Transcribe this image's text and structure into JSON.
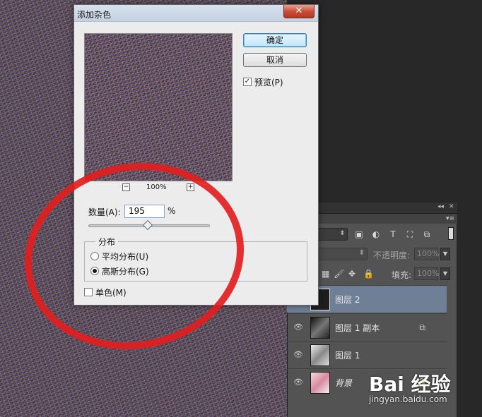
{
  "dialog": {
    "title": "添加杂色",
    "close_label": "✕",
    "zoom": "100%",
    "zoom_out": "−",
    "zoom_in": "+",
    "ok_label": "确定",
    "cancel_label": "取消",
    "preview_label": "预览(P)",
    "preview_checked": "✓",
    "amount_label": "数量(A):",
    "amount_value": "195",
    "amount_unit": "%",
    "distribution_title": "分布",
    "uniform_label": "平均分布(U)",
    "gaussian_label": "高斯分布(G)",
    "mono_label": "单色(M)"
  },
  "layers_panel": {
    "collapse_ctl": "◂◂",
    "close_ctl": "✕",
    "menu_icon": "▾≡",
    "opacity_label": "不透明度:",
    "opacity_value": "100%",
    "fill_label": "填充:",
    "fill_value": "100%",
    "layers": [
      {
        "name": "图层 2"
      },
      {
        "name": "图层 1 副本"
      },
      {
        "name": "图层 1"
      },
      {
        "name": "背景"
      }
    ]
  },
  "watermark": {
    "logo": "Bai 经验",
    "url": "jingyan.baidu.com"
  }
}
